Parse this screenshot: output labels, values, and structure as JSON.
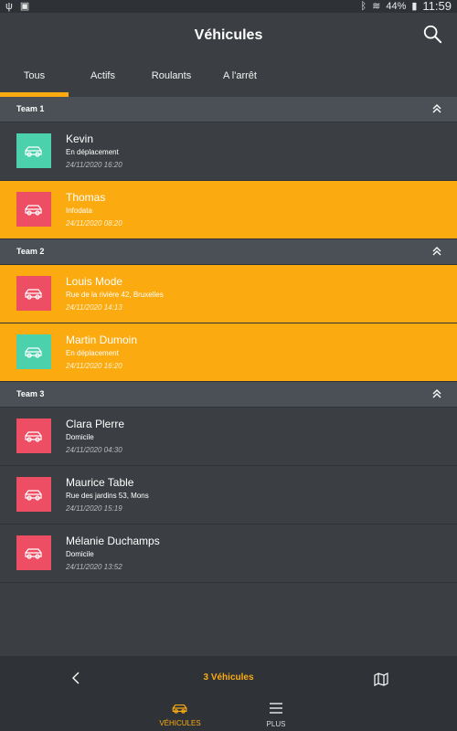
{
  "status_bar": {
    "left_icons": [
      "usb-icon",
      "gallery-icon"
    ],
    "battery": "44%",
    "time": "11:59"
  },
  "header": {
    "title": "Véhicules"
  },
  "tabs": [
    {
      "label": "Tous",
      "active": true
    },
    {
      "label": "Actifs"
    },
    {
      "label": "Roulants"
    },
    {
      "label": "A l'arrêt"
    }
  ],
  "teams": [
    {
      "name": "Team 1",
      "vehicles": [
        {
          "name": "Kevin",
          "status": "En déplacement",
          "time": "24/11/2020 16:20",
          "icon_color": "green",
          "highlighted": false
        },
        {
          "name": "Thomas",
          "status": "Infodata",
          "time": "24/11/2020 08:20",
          "icon_color": "red",
          "highlighted": true
        }
      ]
    },
    {
      "name": "Team 2",
      "vehicles": [
        {
          "name": "Louis Mode",
          "status": "Rue de la rivière 42, Bruxelles",
          "time": "24/11/2020 14:13",
          "icon_color": "red",
          "highlighted": true
        },
        {
          "name": "Martin Dumoin",
          "status": "En déplacement",
          "time": "24/11/2020 16:20",
          "icon_color": "green",
          "highlighted": true
        }
      ]
    },
    {
      "name": "Team 3",
      "vehicles": [
        {
          "name": "Clara Plerre",
          "status": "Domicile",
          "time": "24/11/2020 04:30",
          "icon_color": "red",
          "highlighted": false
        },
        {
          "name": "Maurice Table",
          "status": "Rue des jardins 53, Mons",
          "time": "24/11/2020 15:19",
          "icon_color": "red",
          "highlighted": false
        },
        {
          "name": "Mélanie Duchamps",
          "status": "Domicile",
          "time": "24/11/2020 13:52",
          "icon_color": "red",
          "highlighted": false
        }
      ]
    }
  ],
  "footer": {
    "count_label": "3 Véhicules",
    "nav": [
      {
        "label": "VÉHICULES",
        "active": true
      },
      {
        "label": "PLUS"
      }
    ]
  },
  "colors": {
    "accent": "#fbaa10",
    "background": "#3b3f43",
    "team_header": "#4a5055",
    "icon_green": "#4bd1ac",
    "icon_red": "#ee4e64"
  }
}
